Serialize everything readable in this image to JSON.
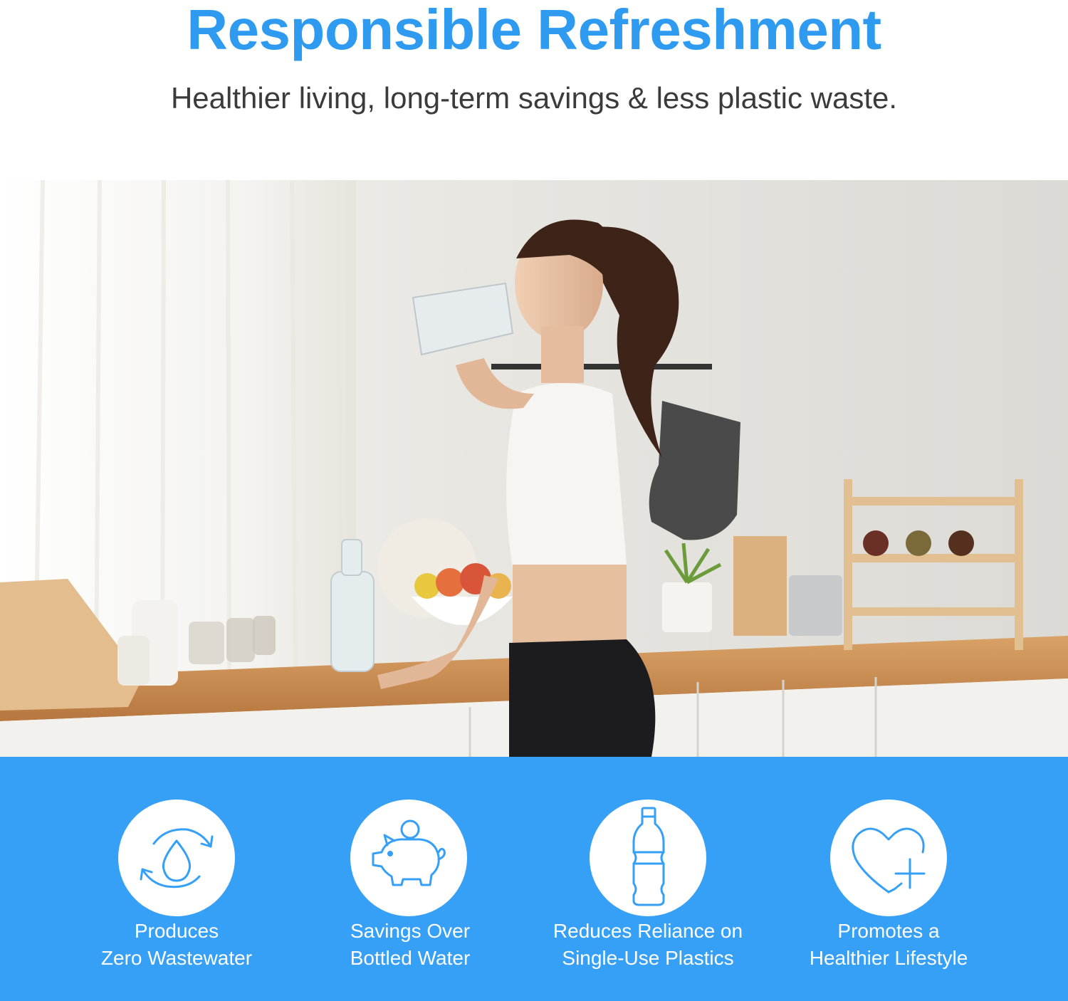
{
  "header": {
    "title": "Responsible Refreshment",
    "subtitle": "Healthier living, long-term savings & less plastic waste."
  },
  "colors": {
    "title_blue": "#2f9bf0",
    "band_blue": "#35a0f5",
    "subtitle_gray": "#3b3b3b"
  },
  "photo": {
    "icon": "woman-drinking-water-in-kitchen-photo"
  },
  "features": [
    {
      "icon": "water-drop-cycle-icon",
      "line1": "Produces",
      "line2": "Zero Wastewater"
    },
    {
      "icon": "piggy-bank-icon",
      "line1": "Savings Over",
      "line2": "Bottled Water"
    },
    {
      "icon": "plastic-bottle-icon",
      "line1": "Reduces Reliance on",
      "line2": "Single-Use Plastics"
    },
    {
      "icon": "heart-plus-icon",
      "line1": "Promotes a",
      "line2": "Healthier Lifestyle"
    }
  ]
}
